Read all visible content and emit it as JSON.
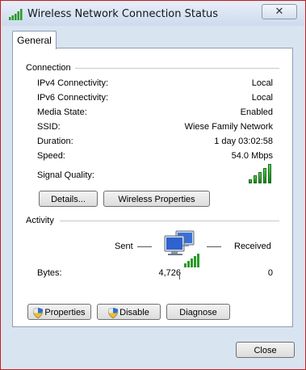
{
  "window": {
    "title": "Wireless Network Connection Status",
    "close_glyph": "✕"
  },
  "tabs": [
    {
      "label": "General"
    }
  ],
  "connection": {
    "heading": "Connection",
    "rows": [
      {
        "label": "IPv4 Connectivity:",
        "value": "Local"
      },
      {
        "label": "IPv6 Connectivity:",
        "value": "Local"
      },
      {
        "label": "Media State:",
        "value": "Enabled"
      },
      {
        "label": "SSID:",
        "value": "Wiese Family Network"
      },
      {
        "label": "Duration:",
        "value": "1 day 03:02:58"
      },
      {
        "label": "Speed:",
        "value": "54.0 Mbps"
      }
    ],
    "signal_label": "Signal Quality:",
    "signal_bars_filled": 5,
    "signal_bars_total": 5,
    "details_button": "Details...",
    "wireless_properties_button": "Wireless Properties"
  },
  "activity": {
    "heading": "Activity",
    "sent_label": "Sent",
    "received_label": "Received",
    "bytes_label": "Bytes:",
    "bytes_sent": "4,726",
    "bytes_received": "0",
    "icon": "network-computers-icon"
  },
  "actions": {
    "properties": "Properties",
    "disable": "Disable",
    "diagnose": "Diagnose",
    "shield_icon": "uac-shield-icon"
  },
  "footer": {
    "close": "Close"
  },
  "colors": {
    "signal_green": "#2a9a2a",
    "window_frame": "#c81e1e"
  }
}
